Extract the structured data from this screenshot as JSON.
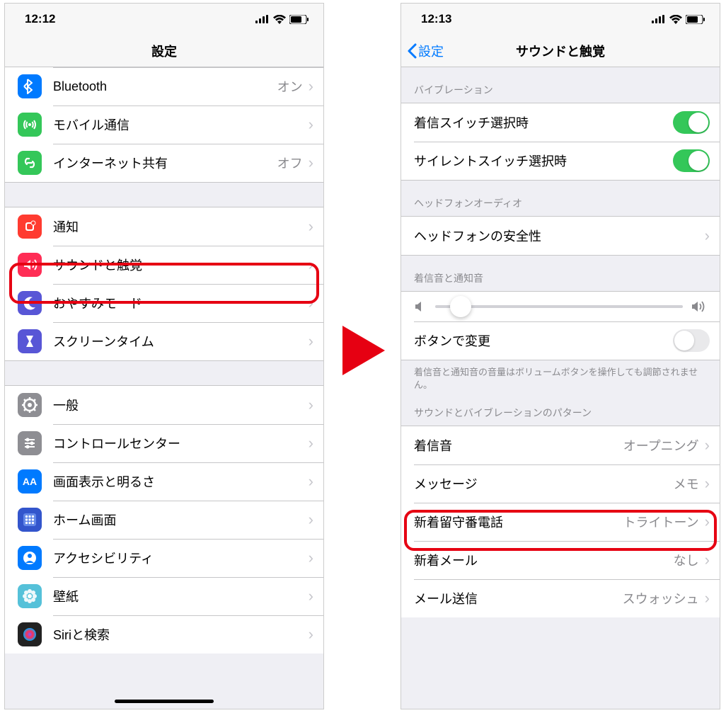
{
  "left": {
    "time": "12:12",
    "title": "設定",
    "items": [
      {
        "id": "bluetooth",
        "label": "Bluetooth",
        "value": "オン",
        "icon_bg": "#007aff",
        "icon": "bluetooth"
      },
      {
        "id": "cellular",
        "label": "モバイル通信",
        "value": "",
        "icon_bg": "#34c759",
        "icon": "antenna"
      },
      {
        "id": "hotspot",
        "label": "インターネット共有",
        "value": "オフ",
        "icon_bg": "#34c759",
        "icon": "link"
      }
    ],
    "items2": [
      {
        "id": "notifications",
        "label": "通知",
        "icon_bg": "#ff3b30",
        "icon": "bell"
      },
      {
        "id": "sounds",
        "label": "サウンドと触覚",
        "icon_bg": "#ff2d55",
        "icon": "speaker",
        "highlight": true
      },
      {
        "id": "dnd",
        "label": "おやすみモード",
        "icon_bg": "#5856d6",
        "icon": "moon"
      },
      {
        "id": "screentime",
        "label": "スクリーンタイム",
        "icon_bg": "#5856d6",
        "icon": "hourglass"
      }
    ],
    "items3": [
      {
        "id": "general",
        "label": "一般",
        "icon_bg": "#8e8e93",
        "icon": "gear"
      },
      {
        "id": "control",
        "label": "コントロールセンター",
        "icon_bg": "#8e8e93",
        "icon": "sliders"
      },
      {
        "id": "display",
        "label": "画面表示と明るさ",
        "icon_bg": "#007aff",
        "icon": "aa"
      },
      {
        "id": "home",
        "label": "ホーム画面",
        "icon_bg": "#3355cc",
        "icon": "grid"
      },
      {
        "id": "accessibility",
        "label": "アクセシビリティ",
        "icon_bg": "#007aff",
        "icon": "person"
      },
      {
        "id": "wallpaper",
        "label": "壁紙",
        "icon_bg": "#55c1d9",
        "icon": "flower"
      },
      {
        "id": "siri",
        "label": "Siriと検索",
        "icon_bg": "#222",
        "icon": "siri"
      }
    ]
  },
  "right": {
    "time": "12:13",
    "back": "設定",
    "title": "サウンドと触覚",
    "section_vibrate": "バイブレーション",
    "vibrate_ring": "着信スイッチ選択時",
    "vibrate_silent": "サイレントスイッチ選択時",
    "section_headphone": "ヘッドフォンオーディオ",
    "headphone_safety": "ヘッドフォンの安全性",
    "section_ringer": "着信音と通知音",
    "change_buttons": "ボタンで変更",
    "footer_text": "着信音と通知音の音量はボリュームボタンを操作しても調節されません。",
    "section_patterns": "サウンドとバイブレーションのパターン",
    "pattern_items": [
      {
        "id": "ringtone",
        "label": "着信音",
        "value": "オープニング",
        "highlight": true
      },
      {
        "id": "texttone",
        "label": "メッセージ",
        "value": "メモ"
      },
      {
        "id": "voicemail",
        "label": "新着留守番電話",
        "value": "トライトーン"
      },
      {
        "id": "newmail",
        "label": "新着メール",
        "value": "なし"
      },
      {
        "id": "sentmail",
        "label": "メール送信",
        "value": "スウォッシュ"
      }
    ]
  }
}
